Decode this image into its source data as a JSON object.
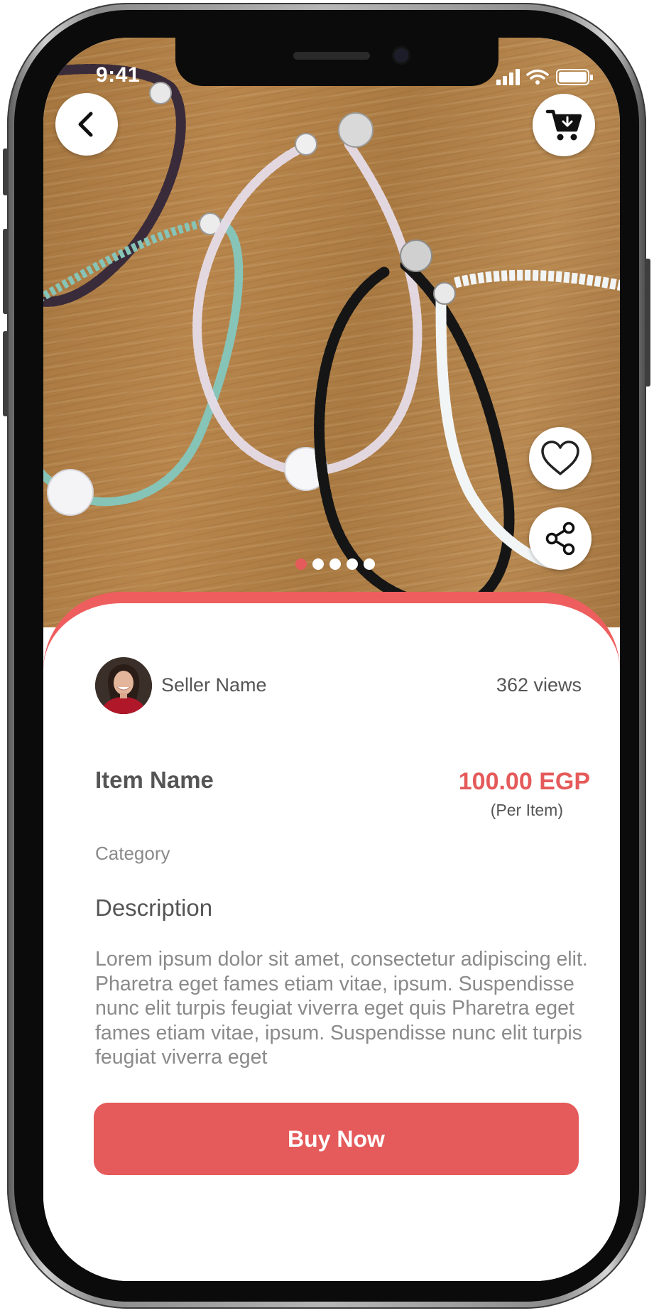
{
  "status_bar": {
    "time": "9:41",
    "icons": [
      "signal-icon",
      "wifi-icon",
      "battery-icon"
    ]
  },
  "header": {
    "back_icon": "chevron-left-icon",
    "cart_icon": "cart-download-icon"
  },
  "gallery": {
    "image": "product-photo-bracelets",
    "page_count": 5,
    "active_page": 1,
    "favorite_icon": "heart-icon",
    "share_icon": "share-icon"
  },
  "seller": {
    "name": "Seller Name",
    "views": "362 views"
  },
  "item": {
    "name": "Item Name",
    "price": "100.00 EGP",
    "price_unit": "(Per Item)",
    "category": "Category"
  },
  "description": {
    "title": "Description",
    "text": "Lorem ipsum dolor sit amet, consectetur adipiscing elit. Pharetra eget fames etiam vitae, ipsum. Suspendisse nunc elit turpis feugiat viverra eget quis Pharetra eget fames etiam vitae, ipsum. Suspendisse nunc elit turpis feugiat viverra eget"
  },
  "actions": {
    "buy_label": "Buy Now"
  },
  "colors": {
    "accent": "#e55a5a",
    "sheet_border": "#ee5e5e",
    "text_primary": "#555555",
    "text_secondary": "#8a8a8a",
    "background": "#ffffff"
  }
}
